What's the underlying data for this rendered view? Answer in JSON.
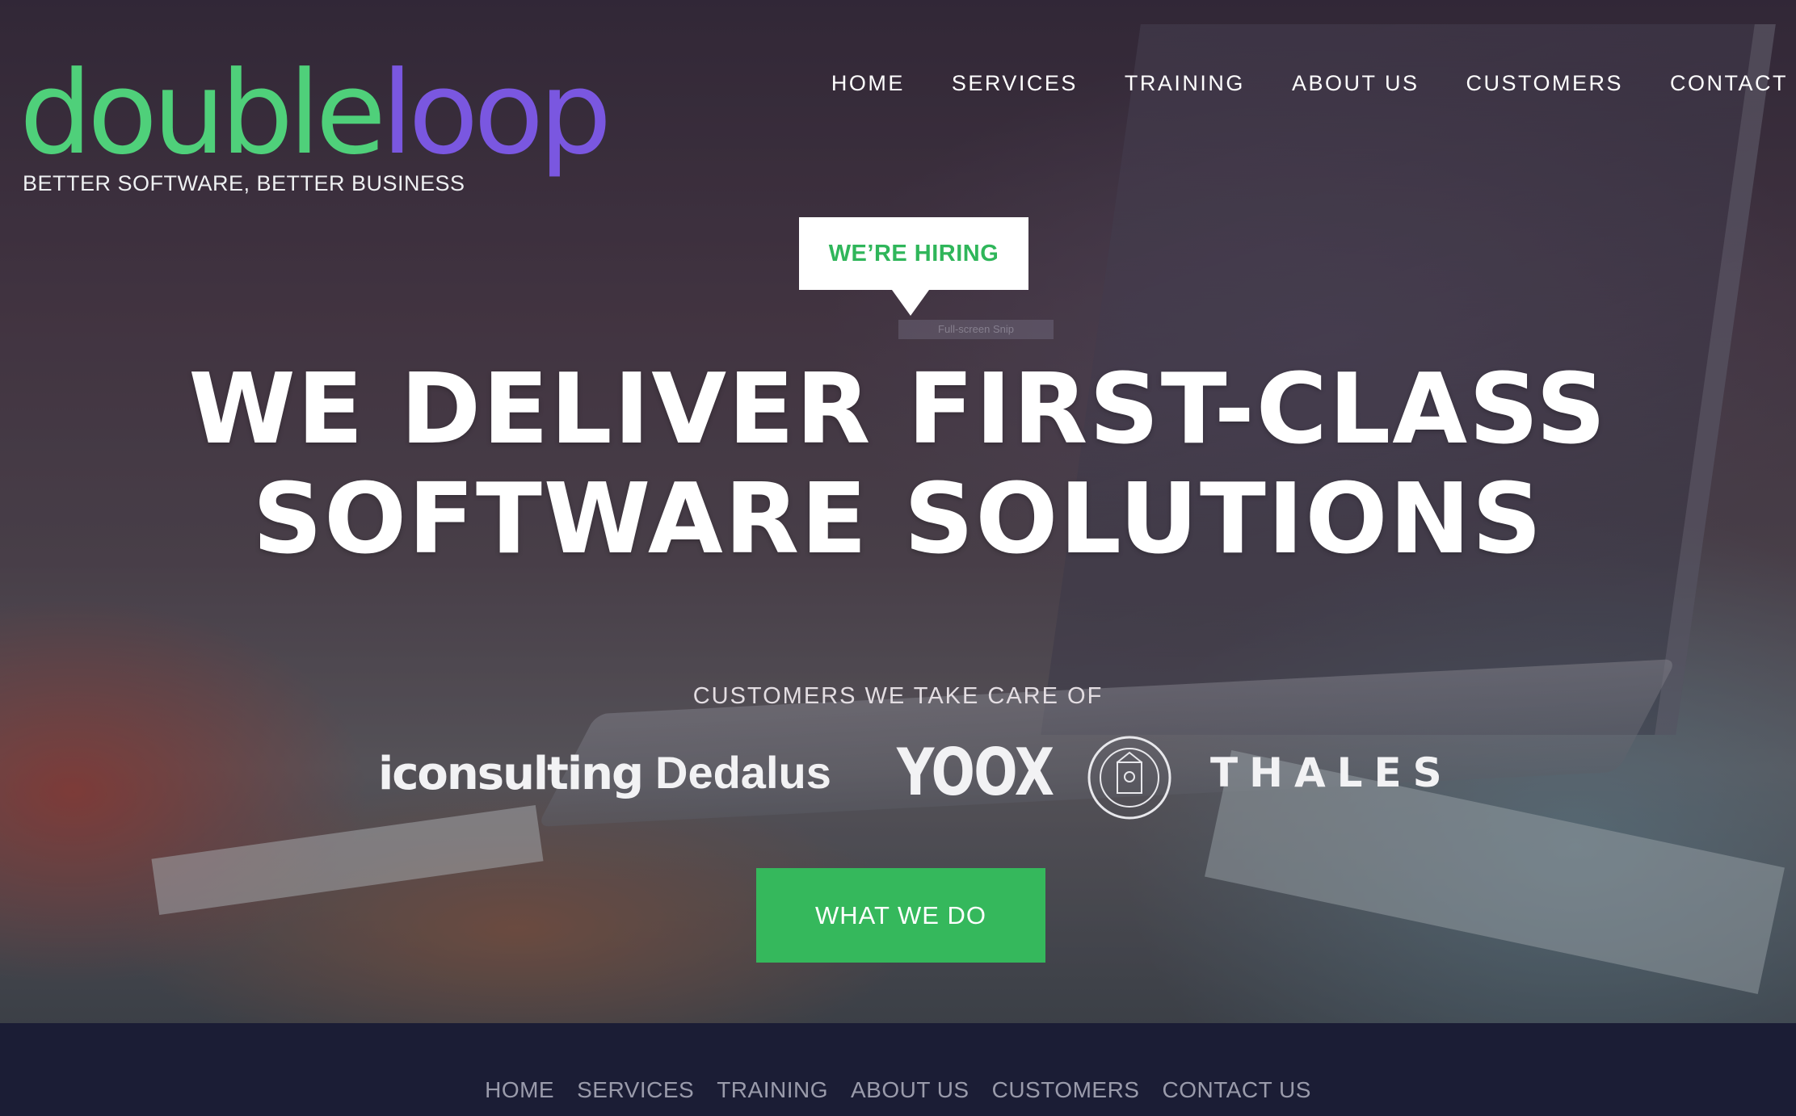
{
  "logo": {
    "word_part1": "double",
    "word_part2": "loop",
    "tagline": "BETTER SOFTWARE, BETTER BUSINESS",
    "color_green": "#4fd07a",
    "color_purple": "#7a57e0"
  },
  "nav": {
    "items": [
      "HOME",
      "SERVICES",
      "TRAINING",
      "ABOUT US",
      "CUSTOMERS",
      "CONTACT"
    ]
  },
  "hiring_badge": {
    "label": "WE’RE HIRING",
    "color": "#2fb65a"
  },
  "snip_overlay": {
    "label": "Full-screen Snip"
  },
  "hero": {
    "headline_line1": "WE DELIVER FIRST-CLASS",
    "headline_line2": "SOFTWARE SOLUTIONS",
    "customers_title": "CUSTOMERS WE TAKE CARE OF",
    "customer_logos": [
      "iconsulting",
      "Dedalus",
      "YOOX",
      "ALMA MATER STUDIORUM A.D. 1088",
      "THALES"
    ],
    "cta_label": "WHAT WE DO",
    "cta_color": "#35b85c"
  },
  "footer": {
    "items": [
      "HOME",
      "SERVICES",
      "TRAINING",
      "ABOUT US",
      "CUSTOMERS",
      "CONTACT US"
    ],
    "background": "#1b1d35"
  }
}
